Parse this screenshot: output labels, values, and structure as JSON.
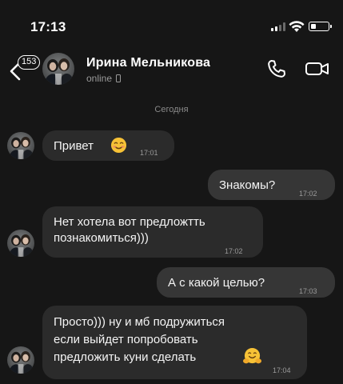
{
  "status_bar": {
    "time": "17:13"
  },
  "header": {
    "back_badge": "153",
    "contact_name": "Ирина Мельникова",
    "status": "online"
  },
  "chat": {
    "date_separator": "Сегодня",
    "messages": [
      {
        "direction": "incoming",
        "text": "Привет",
        "emoji": "smiling-face",
        "time": "17:01"
      },
      {
        "direction": "outgoing",
        "text": "Знакомы?",
        "time": "17:02"
      },
      {
        "direction": "incoming",
        "lines": [
          "Нет хотела вот предложтть",
          "познакомиться)))"
        ],
        "time": "17:02"
      },
      {
        "direction": "outgoing",
        "text": "А с какой целью?",
        "time": "17:03"
      },
      {
        "direction": "incoming",
        "lines": [
          "Просто))) ну и мб подружиться",
          "если выйдет попробовать",
          "предложить куни сделать"
        ],
        "emoji": "hugging-face",
        "time": "17:04"
      }
    ]
  },
  "colors": {
    "background": "#161616",
    "incoming_bubble": "#2b2b2b",
    "outgoing_bubble": "#363636",
    "secondary_text": "#9a9a9a"
  }
}
